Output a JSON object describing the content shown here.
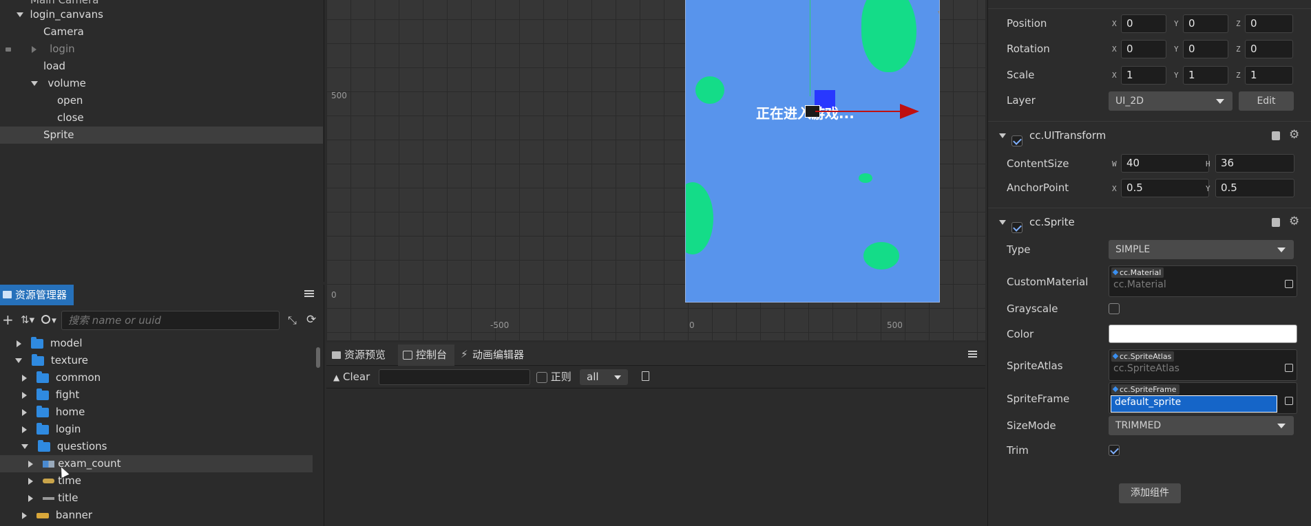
{
  "hierarchy": {
    "items": [
      {
        "label": "Main Camera"
      },
      {
        "label": "login_canvans"
      },
      {
        "label": "Camera"
      },
      {
        "label": "login"
      },
      {
        "label": "load"
      },
      {
        "label": "volume"
      },
      {
        "label": "open"
      },
      {
        "label": "close"
      },
      {
        "label": "Sprite"
      }
    ]
  },
  "assets": {
    "tab_label": "资源管理器",
    "search_placeholder": "搜索 name or uuid",
    "items": [
      {
        "label": "model"
      },
      {
        "label": "texture"
      },
      {
        "label": "common"
      },
      {
        "label": "fight"
      },
      {
        "label": "home"
      },
      {
        "label": "login"
      },
      {
        "label": "questions"
      },
      {
        "label": "exam_count"
      },
      {
        "label": "time"
      },
      {
        "label": "title"
      },
      {
        "label": "banner"
      }
    ]
  },
  "scene": {
    "loading_text": "正在进入游戏...",
    "y_labels": [
      "500",
      "0"
    ],
    "x_labels": [
      "-500",
      "0",
      "500"
    ]
  },
  "console": {
    "tabs": [
      {
        "label": "资源预览"
      },
      {
        "label": "控制台"
      },
      {
        "label": "动画编辑器"
      }
    ],
    "clear_label": "Clear",
    "regex_label": "正则",
    "level_value": "all"
  },
  "inspector": {
    "position": {
      "label": "Position",
      "x": "0",
      "y": "0",
      "z": "0"
    },
    "rotation": {
      "label": "Rotation",
      "x": "0",
      "y": "0",
      "z": "0"
    },
    "scale": {
      "label": "Scale",
      "x": "1",
      "y": "1",
      "z": "1"
    },
    "layer": {
      "label": "Layer",
      "value": "UI_2D",
      "edit_label": "Edit"
    },
    "uitransform": {
      "title": "cc.UITransform",
      "content_size_label": "ContentSize",
      "w": "40",
      "h": "36",
      "anchor_label": "AnchorPoint",
      "ax": "0.5",
      "ay": "0.5"
    },
    "sprite": {
      "title": "cc.Sprite",
      "type_label": "Type",
      "type_value": "SIMPLE",
      "material_label": "CustomMaterial",
      "material_tag": "cc.Material",
      "material_value": "cc.Material",
      "grayscale_label": "Grayscale",
      "color_label": "Color",
      "color_value": "#ffffff",
      "atlas_label": "SpriteAtlas",
      "atlas_tag": "cc.SpriteAtlas",
      "atlas_value": "cc.SpriteAtlas",
      "frame_label": "SpriteFrame",
      "frame_tag": "cc.SpriteFrame",
      "frame_value": "default_sprite",
      "sizemode_label": "SizeMode",
      "sizemode_value": "TRIMMED",
      "trim_label": "Trim"
    },
    "add_component_label": "添加组件",
    "axis_x": "X",
    "axis_y": "Y",
    "axis_z": "Z",
    "axis_w": "W",
    "axis_h": "H"
  },
  "colors": {
    "accent": "#2671bb",
    "canvas": "#5894ec",
    "blob": "#14dc88",
    "selection": "#1565c8"
  }
}
